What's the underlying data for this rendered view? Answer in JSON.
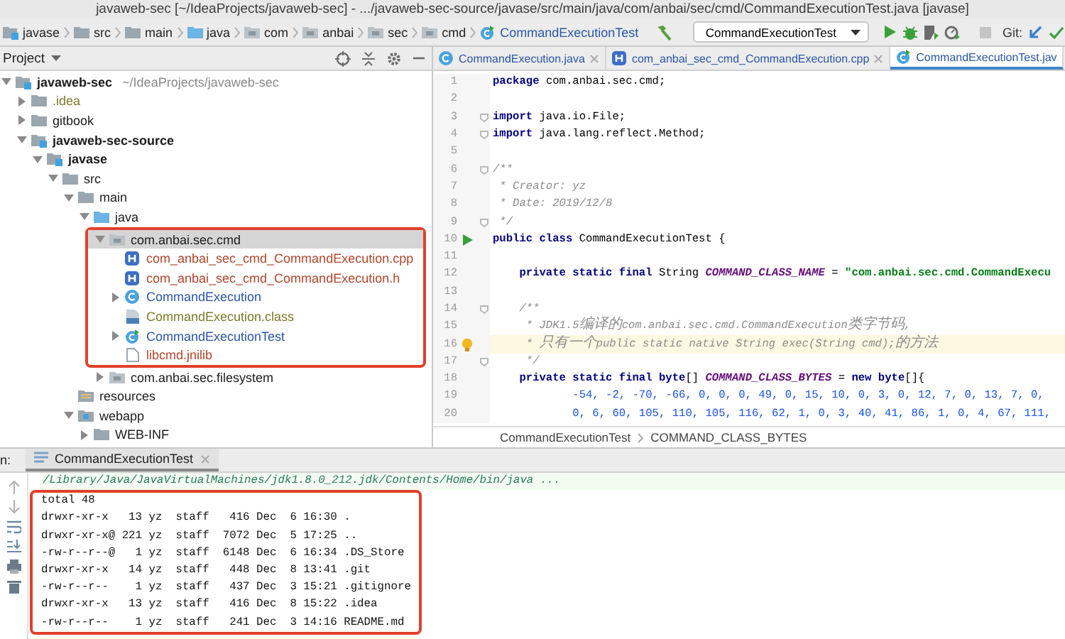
{
  "window": {
    "title": "javaweb-sec [~/IdeaProjects/javaweb-sec] - .../javaweb-sec-source/javase/src/main/java/com/anbai/sec/cmd/CommandExecutionTest.java [javase]"
  },
  "navigation_bar": {
    "crumbs": [
      {
        "label": "javase",
        "kind": "module"
      },
      {
        "label": "src",
        "kind": "folder"
      },
      {
        "label": "main",
        "kind": "folder"
      },
      {
        "label": "java",
        "kind": "source-folder"
      },
      {
        "label": "com",
        "kind": "package"
      },
      {
        "label": "anbai",
        "kind": "package"
      },
      {
        "label": "sec",
        "kind": "package"
      },
      {
        "label": "cmd",
        "kind": "package"
      },
      {
        "label": "CommandExecutionTest",
        "kind": "test-class"
      }
    ],
    "run_configuration": "CommandExecutionTest",
    "vcs_label": "Git:"
  },
  "project_panel": {
    "title": "Project",
    "tree": [
      {
        "label": "javaweb-sec",
        "path": "~/IdeaProjects/javaweb-sec",
        "kind": "module",
        "expanded": true,
        "selected": false,
        "color": "#1a1a1a",
        "children": [
          {
            "label": ".idea",
            "kind": "folder",
            "expanded": false,
            "selected": false,
            "color": "#7a7a2a"
          },
          {
            "label": "gitbook",
            "kind": "folder",
            "expanded": false,
            "selected": false,
            "color": "#1a1a1a"
          },
          {
            "label": "javaweb-sec-source",
            "kind": "module",
            "expanded": true,
            "selected": false,
            "color": "#1a1a1a",
            "children": [
              {
                "label": "javase",
                "kind": "module",
                "expanded": true,
                "selected": false,
                "color": "#1a1a1a",
                "children": [
                  {
                    "label": "src",
                    "kind": "folder",
                    "expanded": true,
                    "selected": false,
                    "color": "#1a1a1a",
                    "children": [
                      {
                        "label": "main",
                        "kind": "folder",
                        "expanded": true,
                        "selected": false,
                        "color": "#1a1a1a",
                        "children": [
                          {
                            "label": "java",
                            "kind": "source-folder",
                            "expanded": true,
                            "selected": false,
                            "color": "#1a1a1a",
                            "children": [
                              {
                                "label": "com.anbai.sec.cmd",
                                "kind": "package",
                                "expanded": true,
                                "selected": true,
                                "framed": true,
                                "color": "#1a1a1a",
                                "children": [
                                  {
                                    "label": "com_anbai_sec_cmd_CommandExecution.cpp",
                                    "kind": "header",
                                    "selected": false,
                                    "color": "#b0452a"
                                  },
                                  {
                                    "label": "com_anbai_sec_cmd_CommandExecution.h",
                                    "kind": "header",
                                    "selected": false,
                                    "color": "#b0452a"
                                  },
                                  {
                                    "label": "CommandExecution",
                                    "kind": "class",
                                    "expanded": false,
                                    "selected": false,
                                    "color": "#2a55a8"
                                  },
                                  {
                                    "label": "CommandExecution.class",
                                    "kind": "class-file",
                                    "selected": false,
                                    "color": "#7a7a2a"
                                  },
                                  {
                                    "label": "CommandExecutionTest",
                                    "kind": "test-class",
                                    "expanded": false,
                                    "selected": false,
                                    "color": "#2a55a8"
                                  },
                                  {
                                    "label": "libcmd.jnilib",
                                    "kind": "file",
                                    "selected": false,
                                    "color": "#b0452a"
                                  }
                                ]
                              },
                              {
                                "label": "com.anbai.sec.filesystem",
                                "kind": "package",
                                "expanded": false,
                                "selected": false,
                                "color": "#1a1a1a"
                              }
                            ]
                          }
                        ]
                      },
                      {
                        "label": "resources",
                        "kind": "resources-folder",
                        "selected": false,
                        "color": "#1a1a1a"
                      },
                      {
                        "label": "webapp",
                        "kind": "web-folder",
                        "expanded": true,
                        "selected": false,
                        "color": "#1a1a1a",
                        "children": [
                          {
                            "label": "WEB-INF",
                            "kind": "folder",
                            "expanded": false,
                            "selected": false,
                            "color": "#1a1a1a"
                          }
                        ]
                      }
                    ]
                  }
                ]
              }
            ]
          }
        ]
      }
    ]
  },
  "editor": {
    "tabs": [
      {
        "label": "CommandExecution.java",
        "kind": "class",
        "selected": false,
        "closable": true
      },
      {
        "label": "com_anbai_sec_cmd_CommandExecution.cpp",
        "kind": "header",
        "selected": false,
        "closable": true
      },
      {
        "label": "CommandExecutionTest.jav",
        "kind": "test-class",
        "selected": true,
        "closable": false
      }
    ],
    "lines": [
      {
        "number": "1",
        "fold": false,
        "run_marker": false,
        "bulb": false,
        "current": false,
        "tokens": [
          {
            "kind": "keyword",
            "text": "package"
          },
          {
            "kind": "plain",
            "text": " com.anbai.sec.cmd;"
          }
        ]
      },
      {
        "number": "2",
        "fold": false,
        "run_marker": false,
        "bulb": false,
        "current": false
      },
      {
        "number": "3",
        "fold": true,
        "run_marker": false,
        "bulb": false,
        "current": false,
        "tokens": [
          {
            "kind": "keyword",
            "text": "import"
          },
          {
            "kind": "plain",
            "text": " java.io.File;"
          }
        ]
      },
      {
        "number": "4",
        "fold": true,
        "run_marker": false,
        "bulb": false,
        "current": false,
        "tokens": [
          {
            "kind": "keyword",
            "text": "import"
          },
          {
            "kind": "plain",
            "text": " java.lang.reflect.Method;"
          }
        ]
      },
      {
        "number": "5",
        "fold": false,
        "run_marker": false,
        "bulb": false,
        "current": false
      },
      {
        "number": "6",
        "fold": true,
        "run_marker": false,
        "bulb": false,
        "current": false,
        "tokens": [
          {
            "kind": "comment",
            "text": "/**"
          }
        ]
      },
      {
        "number": "7",
        "fold": false,
        "run_marker": false,
        "bulb": false,
        "current": false,
        "tokens": [
          {
            "kind": "comment",
            "text": " * Creator: yz"
          }
        ]
      },
      {
        "number": "8",
        "fold": false,
        "run_marker": false,
        "bulb": false,
        "current": false,
        "tokens": [
          {
            "kind": "comment",
            "text": " * Date: 2019/12/8"
          }
        ]
      },
      {
        "number": "9",
        "fold": true,
        "run_marker": false,
        "bulb": false,
        "current": false,
        "tokens": [
          {
            "kind": "comment",
            "text": " */"
          }
        ]
      },
      {
        "number": "10",
        "fold": false,
        "run_marker": true,
        "bulb": false,
        "current": false,
        "tokens": [
          {
            "kind": "keyword",
            "text": "public class"
          },
          {
            "kind": "plain",
            "text": " CommandExecutionTest {"
          }
        ]
      },
      {
        "number": "11",
        "fold": false,
        "run_marker": false,
        "bulb": false,
        "current": false
      },
      {
        "number": "12",
        "fold": false,
        "run_marker": false,
        "bulb": false,
        "current": false,
        "tokens": [
          {
            "kind": "keyword",
            "text": "    private static final"
          },
          {
            "kind": "plain",
            "text": " String "
          },
          {
            "kind": "constant",
            "text": "COMMAND_CLASS_NAME"
          },
          {
            "kind": "plain",
            "text": " = "
          },
          {
            "kind": "string",
            "text": "\"com.anbai.sec.cmd.CommandExecu"
          }
        ]
      },
      {
        "number": "13",
        "fold": false,
        "run_marker": false,
        "bulb": false,
        "current": false
      },
      {
        "number": "14",
        "fold": true,
        "run_marker": false,
        "bulb": false,
        "current": false,
        "tokens": [
          {
            "kind": "comment",
            "text": "    /**"
          }
        ]
      },
      {
        "number": "15",
        "fold": false,
        "run_marker": false,
        "bulb": false,
        "current": false,
        "tokens": [
          {
            "kind": "comment",
            "text": "     * JDK1.5编译的com.anbai.sec.cmd.CommandExecution类字节码,"
          }
        ]
      },
      {
        "number": "16",
        "fold": false,
        "run_marker": false,
        "bulb": true,
        "current": true,
        "tokens": [
          {
            "kind": "comment",
            "text": "     * 只有一个public static native String exec(String cmd);的方法"
          }
        ]
      },
      {
        "number": "17",
        "fold": true,
        "run_marker": false,
        "bulb": false,
        "current": false,
        "tokens": [
          {
            "kind": "comment",
            "text": "     */"
          }
        ]
      },
      {
        "number": "18",
        "fold": false,
        "run_marker": false,
        "bulb": false,
        "current": false,
        "tokens": [
          {
            "kind": "keyword",
            "text": "    private static final byte"
          },
          {
            "kind": "plain",
            "text": "[] "
          },
          {
            "kind": "constant",
            "text": "COMMAND_CLASS_BYTES"
          },
          {
            "kind": "plain",
            "text": " = "
          },
          {
            "kind": "keyword",
            "text": "new byte"
          },
          {
            "kind": "plain",
            "text": "[]{"
          }
        ]
      },
      {
        "number": "19",
        "fold": false,
        "run_marker": false,
        "bulb": false,
        "current": false,
        "tokens": [
          {
            "kind": "number",
            "text": "            -54, -2, -70, -66, 0, 0, 0, 49, 0, 15, 10, 0, 3, 0, 12, 7, 0, 13, 7, 0,"
          }
        ]
      },
      {
        "number": "20",
        "fold": false,
        "run_marker": false,
        "bulb": false,
        "current": false,
        "tokens": [
          {
            "kind": "number",
            "text": "            0, 6, 60, 105, 110, 105, 116, 62, 1, 0, 3, 40, 41, 86, 1, 0, 4, 67, 111,"
          }
        ]
      }
    ],
    "breadcrumbs": [
      "CommandExecutionTest",
      "COMMAND_CLASS_BYTES"
    ]
  },
  "run_panel": {
    "label": "n:",
    "tab": {
      "label": "CommandExecutionTest",
      "selected": true
    },
    "command": "/Library/Java/JavaVirtualMachines/jdk1.8.0_212.jdk/Contents/Home/bin/java ...",
    "output_framed": true,
    "output": [
      "total 48",
      "drwxr-xr-x   13 yz  staff   416 Dec  6 16:30 .",
      "drwxr-xr-x@ 221 yz  staff  7072 Dec  5 17:25 ..",
      "-rw-r--r--@   1 yz  staff  6148 Dec  6 16:34 .DS_Store",
      "drwxr-xr-x   14 yz  staff   448 Dec  8 13:41 .git",
      "-rw-r--r--    1 yz  staff   437 Dec  3 15:21 .gitignore",
      "drwxr-xr-x   13 yz  staff   416 Dec  8 15:22 .idea",
      "-rw-r--r--    1 yz  staff   241 Dec  3 14:16 README.md"
    ]
  }
}
